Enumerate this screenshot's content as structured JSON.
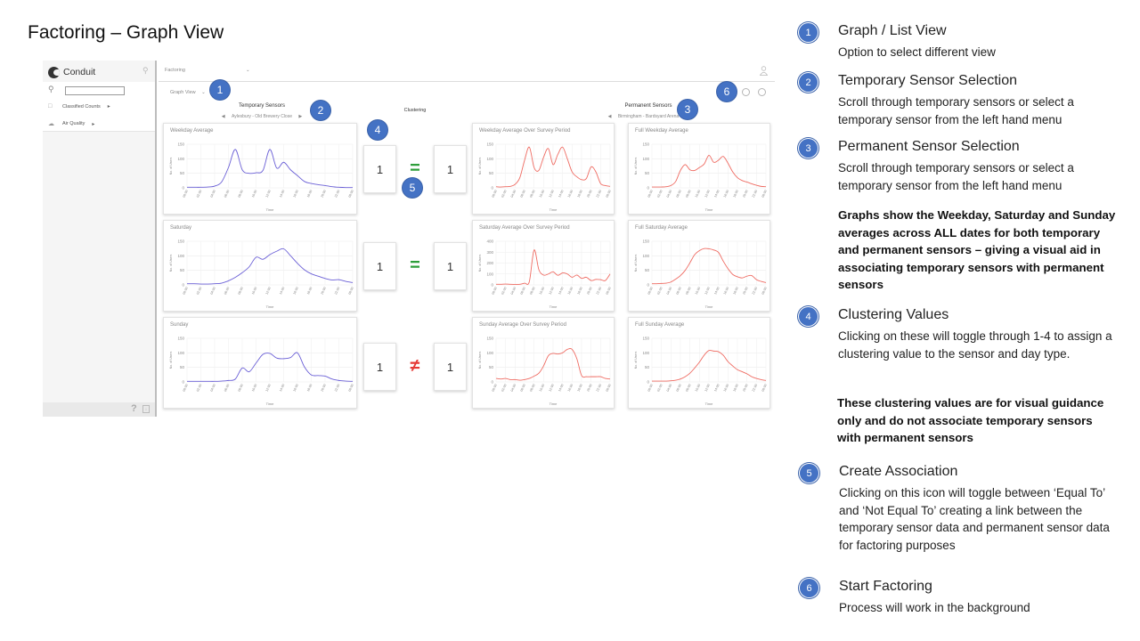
{
  "slide_title": "Factoring – Graph View",
  "app": {
    "logo_text": "Conduit",
    "sidebar_items": [
      {
        "icon": "folder-icon",
        "label": "Classified Counts"
      },
      {
        "icon": "cloud-icon",
        "label": "Air Quality"
      }
    ],
    "topbar_select": "Factoring",
    "view_select": "Graph View",
    "temporary_header": "Temporary Sensors",
    "temporary_sensor": "Aylesbury - Old Brewery Close",
    "clustering_header": "Clustering",
    "permanent_header": "Permanent Sensors",
    "permanent_sensor": "Birmingham - Bardsyard Arena",
    "axis_y_label": "No. of Users",
    "axis_x_label": "Time",
    "time_ticks": [
      "00:00",
      "02:00",
      "04:00",
      "06:00",
      "08:00",
      "10:00",
      "12:00",
      "14:00",
      "16:00",
      "18:00",
      "20:00",
      "22:00",
      "00:00"
    ],
    "colors": {
      "temporary_line": "#6a5fd6",
      "permanent_line": "#ef6b62",
      "equal": "#2e9e3a",
      "not_equal": "#e53935",
      "badge": "#4472c4"
    },
    "rows": [
      {
        "temp": {
          "title": "Weekday Average",
          "yticks": [
            "150",
            "100",
            "50",
            "0"
          ],
          "ymax": 150,
          "values": [
            2,
            2,
            2,
            3,
            6,
            20,
            70,
            132,
            62,
            50,
            52,
            60,
            132,
            68,
            88,
            62,
            42,
            22,
            15,
            11,
            8,
            4,
            2,
            1,
            1
          ]
        },
        "clust_left": "1",
        "assoc": "=",
        "assoc_type": "equal",
        "clust_right": "1",
        "perm1": {
          "title": "Weekday Average Over Survey Period",
          "yticks": [
            "150",
            "100",
            "50",
            "0"
          ],
          "ymax": 150,
          "values": [
            4,
            3,
            4,
            5,
            12,
            35,
            95,
            140,
            70,
            60,
            105,
            135,
            80,
            115,
            140,
            100,
            55,
            38,
            28,
            32,
            72,
            55,
            15,
            8,
            5
          ]
        },
        "perm2": {
          "title": "Full Weekday Average",
          "yticks": [
            "150",
            "100",
            "50",
            "0"
          ],
          "ymax": 150,
          "values": [
            3,
            3,
            3,
            4,
            8,
            22,
            60,
            80,
            62,
            60,
            70,
            82,
            112,
            88,
            95,
            108,
            85,
            55,
            35,
            25,
            20,
            14,
            9,
            5,
            4
          ]
        }
      },
      {
        "temp": {
          "title": "Saturday",
          "yticks": [
            "150",
            "100",
            "50",
            "0"
          ],
          "ymax": 150,
          "values": [
            4,
            4,
            3,
            3,
            4,
            6,
            14,
            26,
            42,
            62,
            95,
            88,
            104,
            116,
            124,
            100,
            74,
            52,
            38,
            30,
            22,
            17,
            18,
            12,
            8
          ]
        },
        "clust_left": "1",
        "assoc": "=",
        "assoc_type": "equal",
        "clust_right": "1",
        "perm1": {
          "title": "Saturday Average Over Survey Period",
          "yticks": [
            "400",
            "300",
            "200",
            "100",
            "0"
          ],
          "ymax": 400,
          "values": [
            6,
            6,
            8,
            6,
            5,
            6,
            16,
            30,
            320,
            140,
            90,
            100,
            120,
            88,
            110,
            100,
            70,
            90,
            60,
            70,
            40,
            50,
            48,
            40,
            100
          ]
        },
        "perm2": {
          "title": "Full Saturday Average",
          "yticks": [
            "150",
            "100",
            "50",
            "0"
          ],
          "ymax": 150,
          "values": [
            4,
            4,
            5,
            6,
            10,
            20,
            32,
            50,
            76,
            104,
            118,
            125,
            124,
            120,
            112,
            82,
            56,
            36,
            28,
            24,
            30,
            32,
            18,
            12,
            8
          ]
        }
      },
      {
        "temp": {
          "title": "Sunday",
          "yticks": [
            "150",
            "100",
            "50",
            "0"
          ],
          "ymax": 150,
          "values": [
            2,
            2,
            2,
            2,
            2,
            3,
            5,
            10,
            48,
            35,
            65,
            95,
            98,
            82,
            80,
            84,
            100,
            52,
            24,
            22,
            20,
            10,
            5,
            3,
            2
          ]
        },
        "clust_left": "1",
        "assoc": "≠",
        "assoc_type": "not_equal",
        "clust_right": "1",
        "perm1": {
          "title": "Sunday Average Over Survey Period",
          "yticks": [
            "150",
            "100",
            "50",
            "0"
          ],
          "ymax": 150,
          "values": [
            12,
            10,
            12,
            8,
            8,
            6,
            8,
            12,
            20,
            30,
            55,
            90,
            98,
            96,
            100,
            112,
            112,
            80,
            22,
            18,
            18,
            18,
            18,
            12,
            10
          ]
        },
        "perm2": {
          "title": "Full Sunday Average",
          "yticks": [
            "150",
            "100",
            "50",
            "0"
          ],
          "ymax": 150,
          "values": [
            3,
            3,
            3,
            3,
            4,
            6,
            10,
            18,
            30,
            48,
            68,
            92,
            108,
            106,
            104,
            92,
            70,
            55,
            42,
            35,
            28,
            18,
            12,
            8,
            5
          ]
        }
      }
    ]
  },
  "badges": [
    "1",
    "2",
    "3",
    "4",
    "5",
    "6"
  ],
  "annotations": [
    {
      "num": "1",
      "title": "Graph / List View",
      "desc": "Option to select different view"
    },
    {
      "num": "2",
      "title": "Temporary Sensor Selection",
      "desc": "Scroll through temporary sensors or select a temporary sensor from the left hand menu"
    },
    {
      "num": "3",
      "title": "Permanent Sensor Selection",
      "desc": "Scroll through temporary sensors or select a temporary sensor from the left hand menu"
    },
    {
      "num": "4",
      "title": "Clustering Values",
      "desc": "Clicking on these will toggle through 1-4 to assign a clustering value to the sensor and day type."
    },
    {
      "num": "5",
      "title": "Create Association",
      "desc": "Clicking on this icon will toggle between ‘Equal To’ and ‘Not Equal To’ creating a link between the temporary sensor data and permanent sensor data for factoring purposes"
    },
    {
      "num": "6",
      "title": "Start Factoring",
      "desc": "Process will work in the background"
    }
  ],
  "notes": {
    "graphs": "Graphs show the Weekday, Saturday and Sunday averages across ALL dates for both temporary and permanent sensors – giving a visual aid in associating temporary sensors with permanent sensors",
    "clustering": "These clustering values are for visual guidance only and do not associate temporary sensors with permanent sensors"
  }
}
